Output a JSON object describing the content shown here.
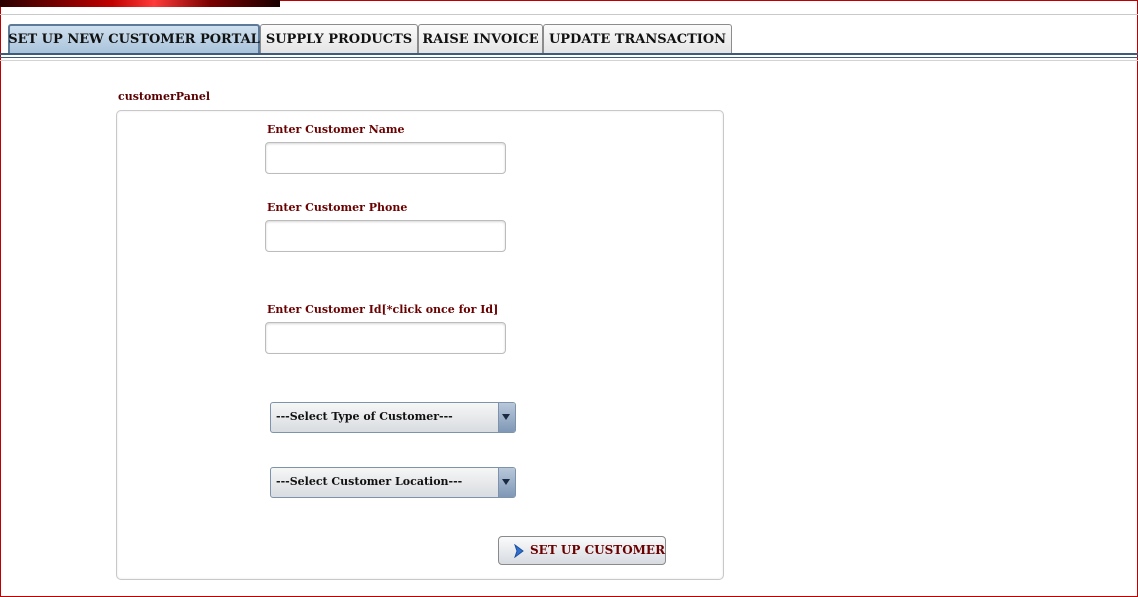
{
  "tabs": [
    {
      "label": "SET UP NEW CUSTOMER PORTAL",
      "active": true
    },
    {
      "label": "SUPPLY PRODUCTS",
      "active": false
    },
    {
      "label": "RAISE INVOICE",
      "active": false
    },
    {
      "label": "UPDATE TRANSACTION",
      "active": false
    }
  ],
  "panel": {
    "title": "customerPanel",
    "fields": {
      "name": {
        "label": "Enter Customer Name",
        "value": ""
      },
      "phone": {
        "label": "Enter Customer Phone",
        "value": ""
      },
      "id": {
        "label": "Enter Customer Id[*click once for Id]",
        "value": ""
      }
    },
    "customer_type": {
      "selected": "---Select Type of Customer---"
    },
    "customer_location": {
      "selected": "---Select Customer Location---"
    },
    "submit": {
      "label": "SET UP CUSTOMER",
      "icon": "arrow-right-icon"
    }
  },
  "colors": {
    "label_text": "#6a0000",
    "active_tab": "#a9c3da",
    "frame_border": "#c00000"
  }
}
